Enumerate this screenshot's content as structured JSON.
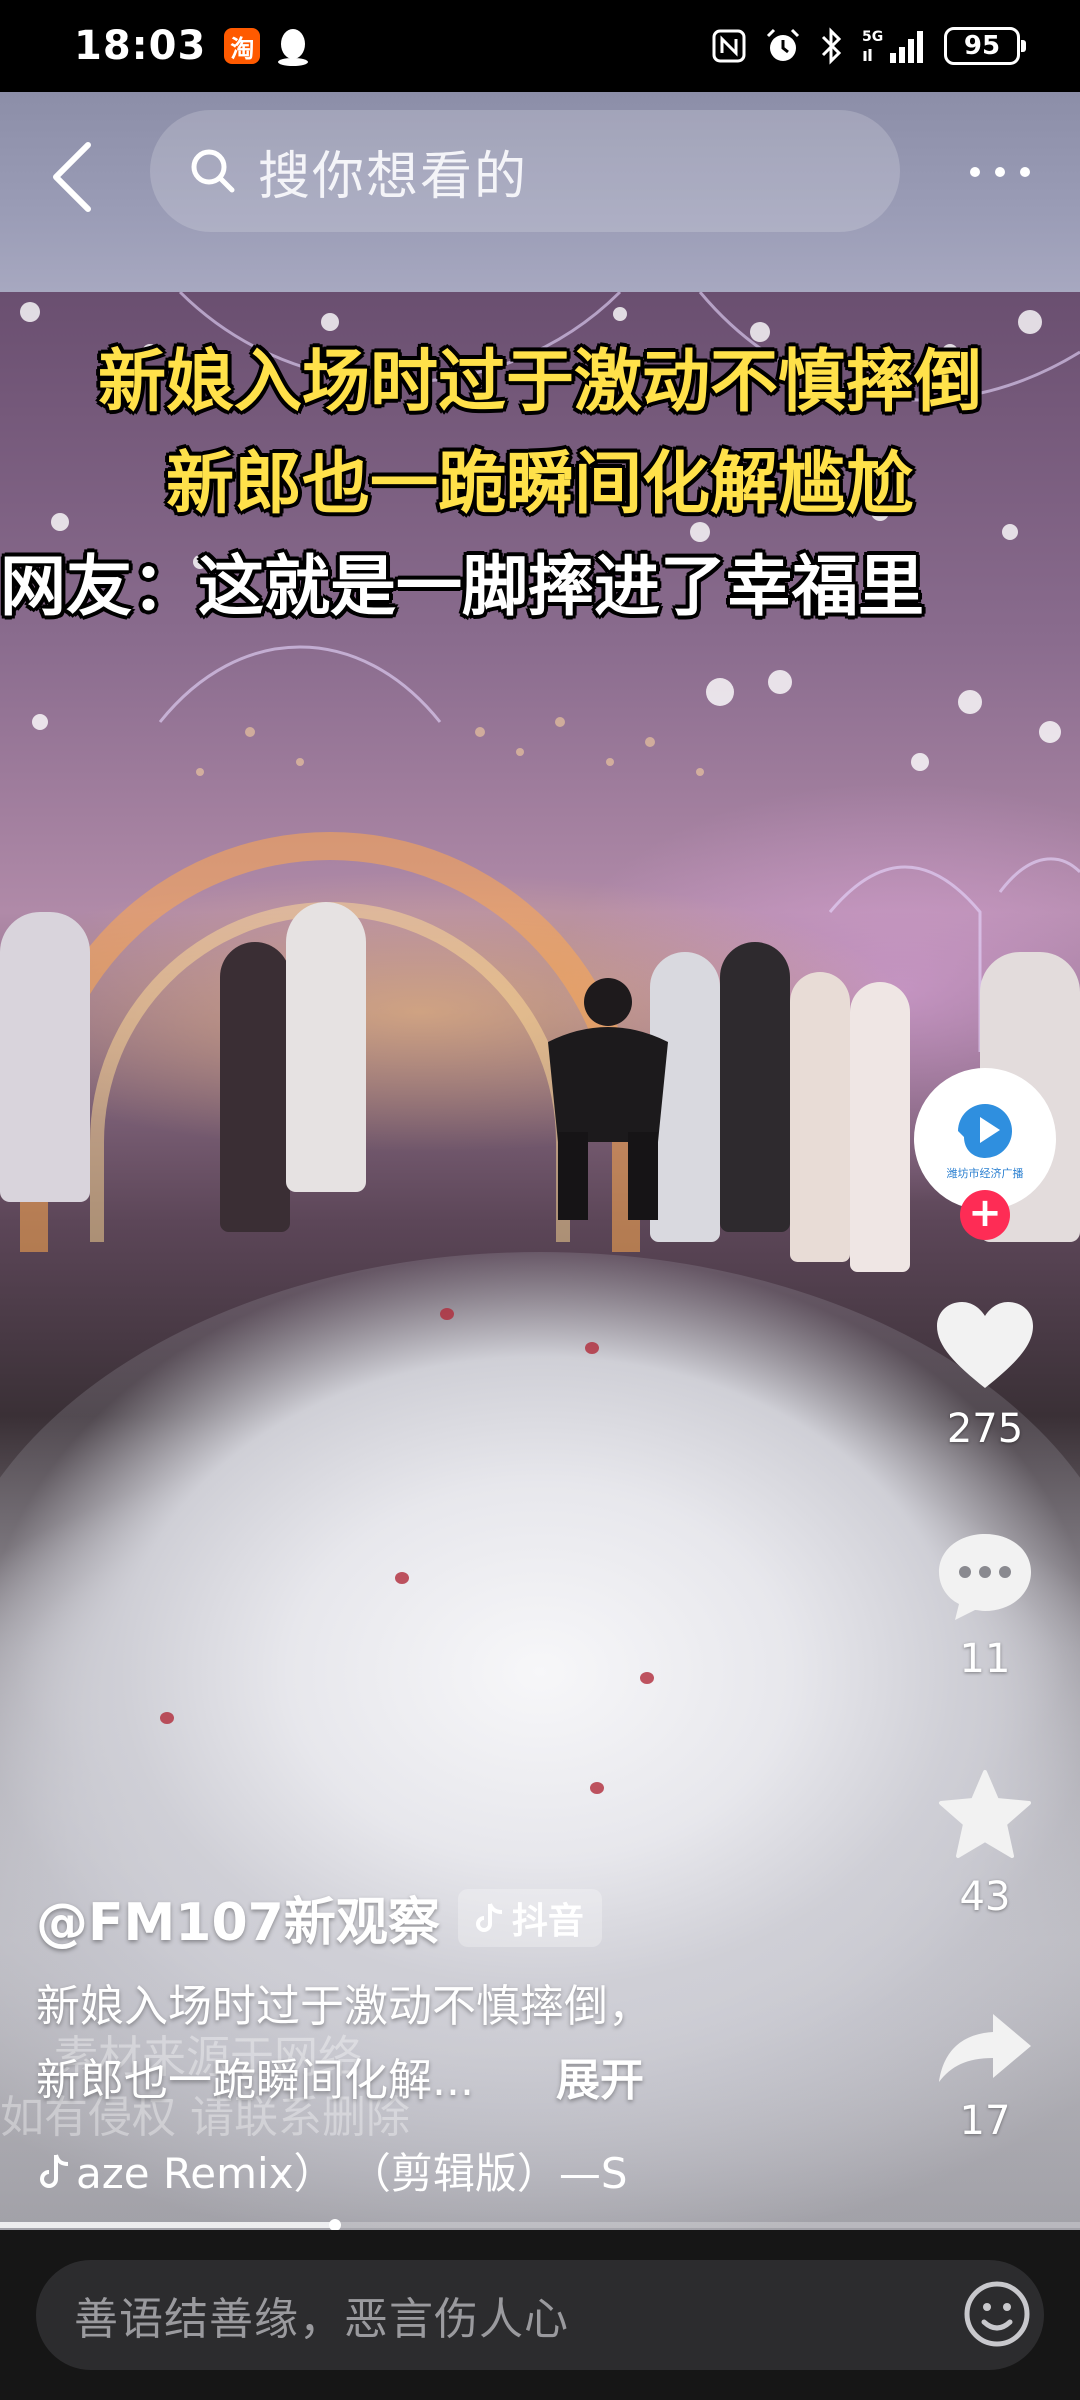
{
  "status_bar": {
    "time": "18:03",
    "app_badge": "淘",
    "network": "5G",
    "battery": "95"
  },
  "header": {
    "search_placeholder": "搜你想看的"
  },
  "video": {
    "caption_line1": "新娘入场时过于激动不慎摔倒",
    "caption_line2": "新郎也一跪瞬间化解尴尬",
    "caption_line3": "网友：这就是一脚摔进了幸福里",
    "watermark_line1": "素材来源于网络",
    "watermark_line2": "如有侵权 请联系删除"
  },
  "author": {
    "avatar_text": "潍坊市经济广播",
    "name": "@FM107新观察",
    "source": "抖音"
  },
  "actions": {
    "likes": "275",
    "comments": "11",
    "favorites": "43",
    "shares": "17"
  },
  "description": {
    "line1": "新娘入场时过于激动不慎摔倒，",
    "line2": "新郎也一跪瞬间化解...",
    "expand_label": "展开"
  },
  "music": {
    "title": "aze Remix）  （剪辑版）—S"
  },
  "progress": {
    "fraction": 0.31
  },
  "comment_bar": {
    "placeholder": "善语结善缘，恶言伤人心"
  },
  "colors": {
    "accent": "#fe2c55",
    "caption_yellow": "#ffe14a",
    "comment_bar_bg": "#161616"
  }
}
